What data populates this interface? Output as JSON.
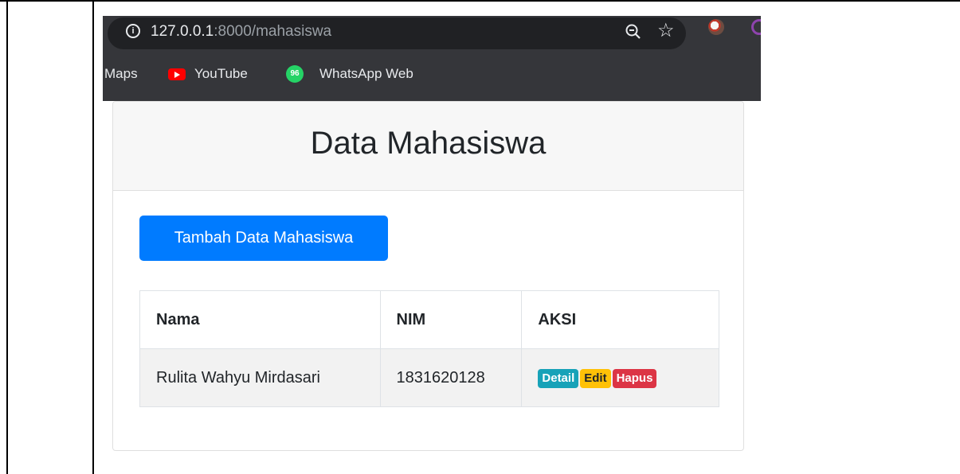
{
  "browser": {
    "url_host": "127.0.0.1",
    "url_path": ":8000/mahasiswa",
    "bookmarks": [
      "Maps",
      "YouTube",
      "WhatsApp Web"
    ],
    "whatsapp_badge": "96"
  },
  "page": {
    "title": "Data Mahasiswa",
    "add_button": "Tambah Data Mahasiswa",
    "table": {
      "headers": [
        "Nama",
        "NIM",
        "AKSI"
      ],
      "rows": [
        {
          "nama": "Rulita Wahyu Mirdasari",
          "nim": "1831620128",
          "actions": [
            "Detail",
            "Edit",
            "Hapus"
          ]
        }
      ]
    }
  },
  "colors": {
    "primary": "#007bff",
    "info": "#17a2b8",
    "warning": "#ffc107",
    "danger": "#dc3545"
  }
}
